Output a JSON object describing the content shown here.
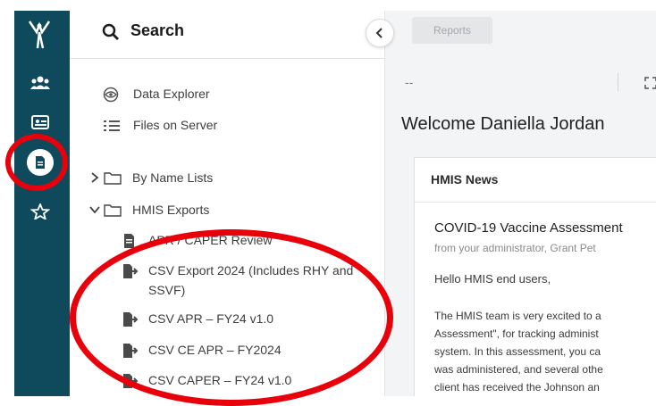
{
  "rail": {
    "icons": [
      "logo-icon",
      "people-icon",
      "id-card-icon",
      "document-icon",
      "star-icon"
    ],
    "active": "document-icon",
    "color": "#0e4a5c"
  },
  "search": {
    "label": "Search"
  },
  "nav": {
    "items": [
      {
        "label": "Data Explorer",
        "icon": "eye-icon"
      },
      {
        "label": "Files on Server",
        "icon": "list-icon"
      }
    ],
    "tree": [
      {
        "label": "By Name Lists",
        "expanded": false
      },
      {
        "label": "HMIS Exports",
        "expanded": true
      }
    ],
    "reports": [
      {
        "label": "APR / CAPER Review"
      },
      {
        "label": "CSV Export 2024 (Includes RHY and SSVF)"
      },
      {
        "label": "CSV APR – FY24 v1.0"
      },
      {
        "label": "CSV CE APR – FY2024"
      },
      {
        "label": "CSV CAPER – FY24 v1.0"
      }
    ]
  },
  "main": {
    "reports_button": "Reports",
    "dash": "--",
    "welcome": "Welcome Daniella Jordan",
    "card_title": "HMIS News",
    "news": {
      "title": "COVID-19 Vaccine Assessment",
      "from": "from your administrator, Grant Pet",
      "greeting": "Hello HMIS end users,",
      "lines": [
        "The HMIS team is very excited to a",
        "Assessment\", for tracking administ",
        "system. In this assessment, you ca",
        "was administered, and several othe",
        "client has received the Johnson an"
      ]
    }
  },
  "annotation_color": "#e8000b"
}
